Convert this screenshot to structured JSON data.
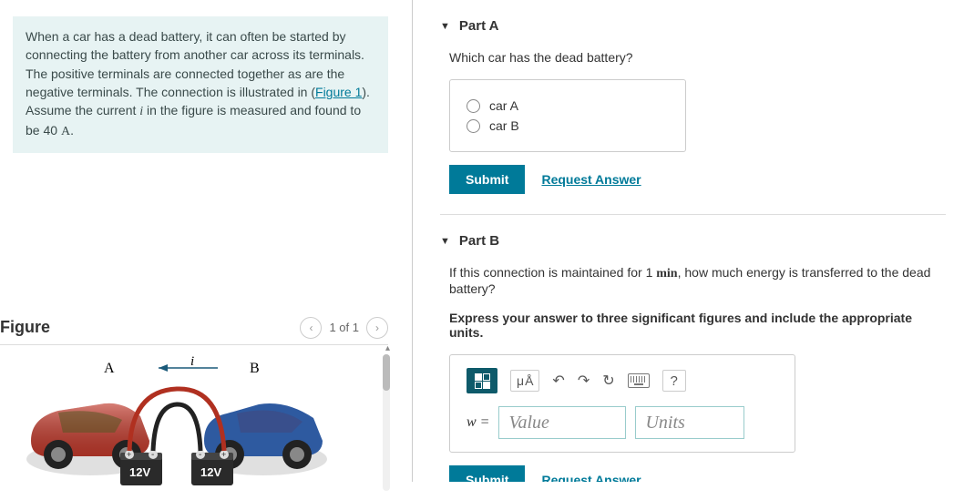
{
  "problem": {
    "text_before_link": "When a car has a dead battery, it can often be started by connecting the battery from another car across its terminals. The positive terminals are connected together as are the negative terminals. The connection is illustrated in (",
    "figure_link": "Figure 1",
    "text_middle": "). Assume the current ",
    "current_var": "i",
    "text_after": " in the figure is measured and found to be 40 ",
    "current_unit": "A",
    "period": "."
  },
  "figure": {
    "heading": "Figure",
    "counter": "1 of 1",
    "labelA": "A",
    "labelB": "B",
    "current_label": "i",
    "voltage": "12V"
  },
  "partA": {
    "title": "Part A",
    "question": "Which car has the dead battery?",
    "options": {
      "a": "car A",
      "b": "car B"
    },
    "submit": "Submit",
    "request": "Request Answer"
  },
  "partB": {
    "title": "Part B",
    "q_before": "If this connection is maintained for ",
    "q_time_num": "1",
    "q_time_unit": "min",
    "q_after": ", how much energy is transferred to the dead battery?",
    "instruction": "Express your answer to three significant figures and include the appropriate units.",
    "toolbar": {
      "ua_mu": "μ",
      "ua_A": "Å",
      "help": "?"
    },
    "eq_lhs": "w =",
    "value_placeholder": "Value",
    "units_placeholder": "Units",
    "submit": "Submit",
    "request": "Request Answer"
  }
}
